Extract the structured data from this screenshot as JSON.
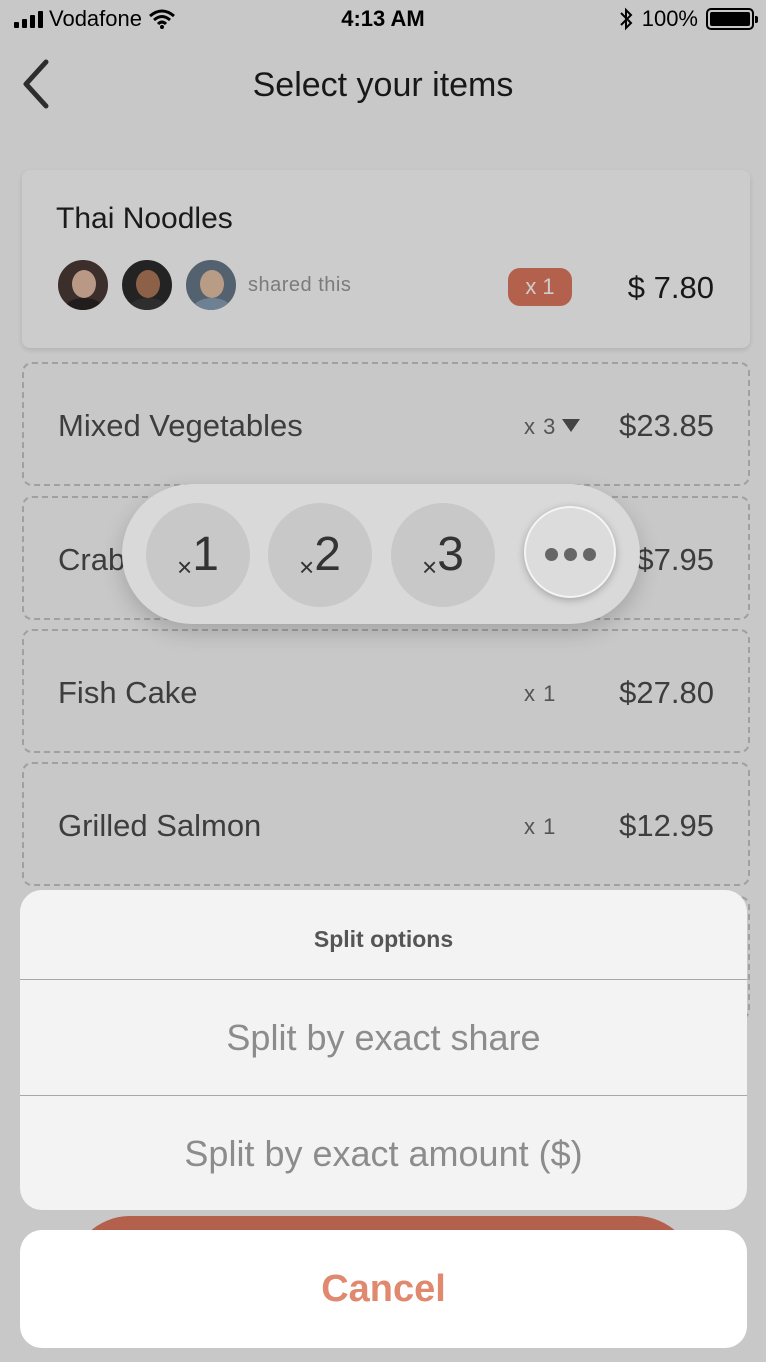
{
  "status_bar": {
    "carrier": "Vodafone",
    "time": "4:13 AM",
    "battery": "100%"
  },
  "nav": {
    "title": "Select your items"
  },
  "main_item": {
    "name": "Thai Noodles",
    "shared_text": "shared this",
    "qty": "x 1",
    "price": "$ 7.80"
  },
  "items": [
    {
      "name": "Mixed Vegetables",
      "qty": "x 3",
      "price": "$23.85"
    },
    {
      "name": "Crab",
      "qty": "",
      "price": "$7.95"
    },
    {
      "name": "Fish Cake",
      "qty": "x 1",
      "price": "$27.80"
    },
    {
      "name": "Grilled Salmon",
      "qty": "x 1",
      "price": "$12.95"
    }
  ],
  "picker": {
    "x": "×",
    "options": [
      "1",
      "2",
      "3"
    ]
  },
  "sheet": {
    "title": "Split options",
    "options": [
      "Split by exact share",
      "Split by exact amount ($)"
    ],
    "cancel": "Cancel"
  },
  "colors": {
    "accent": "#e07a5f",
    "cancel_text": "#e0896e"
  },
  "icons": [
    "signal-icon",
    "wifi-icon",
    "bluetooth-icon",
    "battery-icon",
    "back-chevron-icon",
    "dropdown-caret-icon",
    "more-dots-icon"
  ]
}
